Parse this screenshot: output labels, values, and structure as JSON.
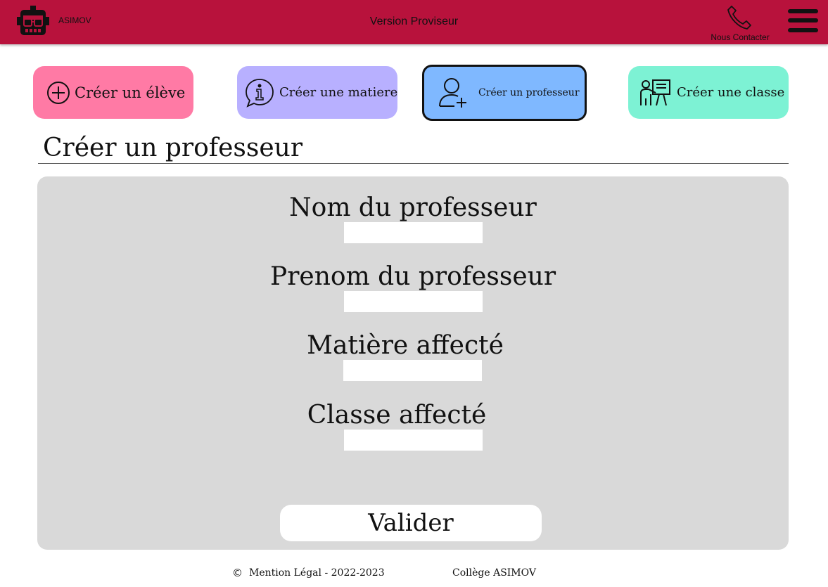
{
  "header": {
    "brand": "ASIMOV",
    "version": "Version Proviseur",
    "contact_label": "Nous Contacter",
    "logo_icon": "robot-logo-icon",
    "contact_icon": "phone-icon",
    "menu_icon": "hamburger-menu-icon"
  },
  "actions": [
    {
      "label": "Créer un élève",
      "icon": "plus-circle-icon",
      "color": "#ff7aa5"
    },
    {
      "label": "Créer une matiere",
      "icon": "info-bubble-icon",
      "color": "#b8b0ff"
    },
    {
      "label": "Créer un professeur",
      "icon": "user-add-icon",
      "color": "#7fb8ff",
      "active": true
    },
    {
      "label": "Créer une classe",
      "icon": "teacher-board-icon",
      "color": "#7df2d4"
    }
  ],
  "page": {
    "title": "Créer un professeur"
  },
  "form": {
    "fields": [
      {
        "label": "Nom du professeur",
        "value": ""
      },
      {
        "label": "Prenom du professeur",
        "value": ""
      },
      {
        "label": "Matière affecté",
        "value": ""
      },
      {
        "label": "Classe affecté",
        "value": ""
      }
    ],
    "submit_label": "Valider"
  },
  "footer": {
    "copyright_symbol": "©",
    "legal": "Mention Légal - 2022-2023",
    "college": "Collège ASIMOV"
  },
  "colors": {
    "header": "#b8123c",
    "card": "#d9d9d9"
  }
}
